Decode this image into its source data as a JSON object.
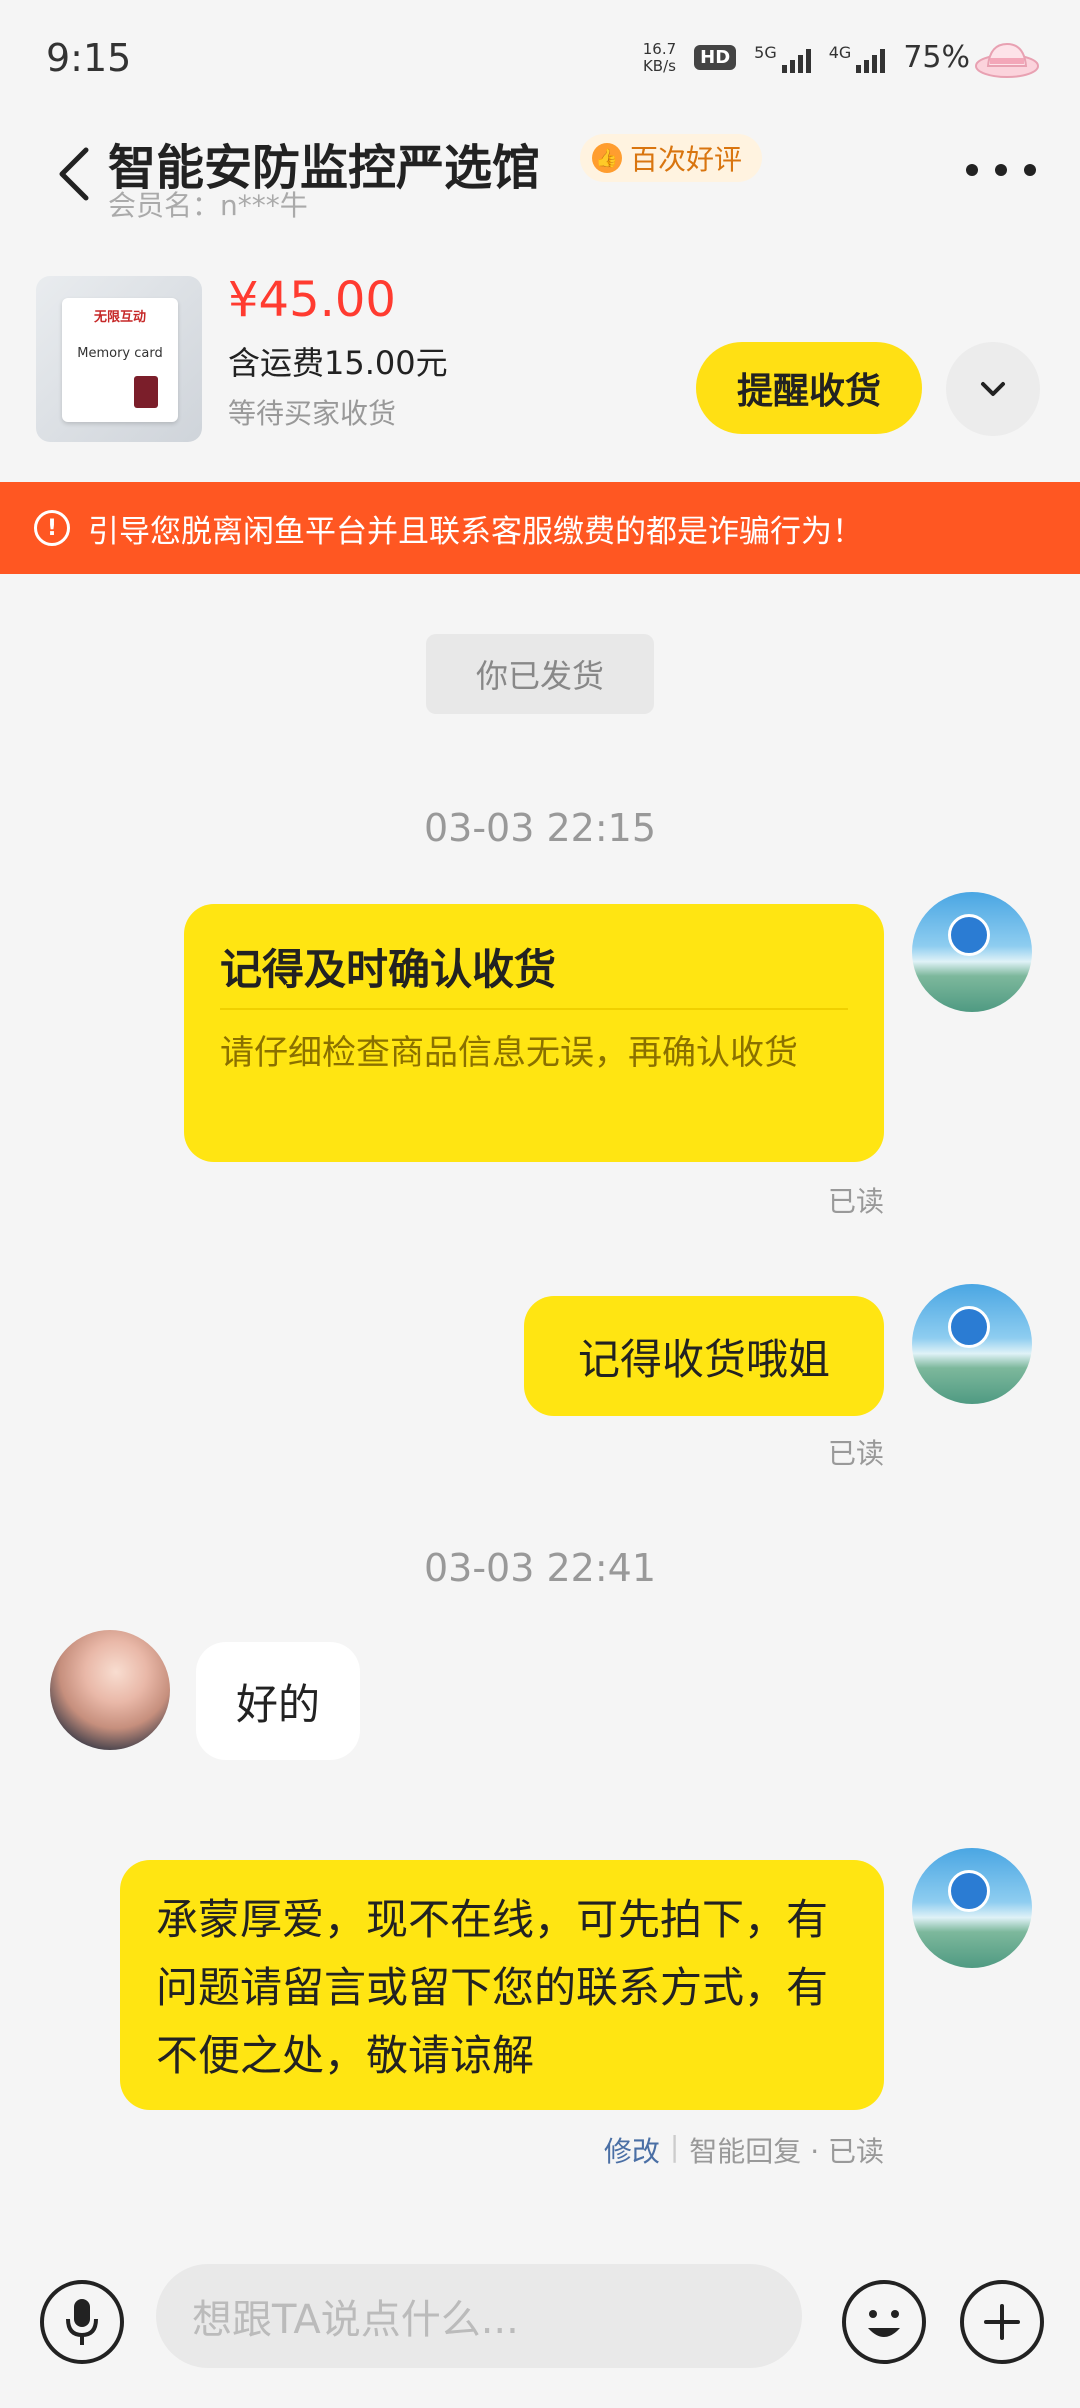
{
  "status_bar": {
    "time": "9:15",
    "net_speed_value": "16.7",
    "net_speed_unit": "KB/s",
    "hd_label": "HD",
    "sim1_label": "5G",
    "sim2_label": "4G",
    "battery": "75%"
  },
  "header": {
    "shop_name": "智能安防监控严选馆",
    "rating_badge": "百次好评",
    "member_label": "会员名：n***牛"
  },
  "product": {
    "thumb_brand": "无限互动",
    "thumb_title": "Memory card",
    "price": "¥45.00",
    "shipping": "含运费15.00元",
    "status": "等待买家收货",
    "remind_button": "提醒收货"
  },
  "warning": {
    "text": "引导您脱离闲鱼平台并且联系客服缴费的都是诈骗行为！"
  },
  "chat": {
    "system_message": "你已发货",
    "timestamp_1": "03-03 22:15",
    "card_title": "记得及时确认收货",
    "card_body": "请仔细检查商品信息无误，再确认收货",
    "read_1": "已读",
    "message_2": "记得收货哦姐",
    "read_2": "已读",
    "timestamp_2": "03-03 22:41",
    "reply": "好的",
    "auto_reply": "承蒙厚爱，现不在线，可先拍下，有问题请留言或留下您的联系方式，有不便之处，敬请谅解",
    "edit_link": "修改",
    "auto_reply_meta": "智能回复 · 已读"
  },
  "footer": {
    "input_placeholder": "想跟TA说点什么..."
  },
  "colors": {
    "accent_yellow": "#ffe512",
    "warning_orange": "#ff5722",
    "price_red": "#ff3b30"
  }
}
